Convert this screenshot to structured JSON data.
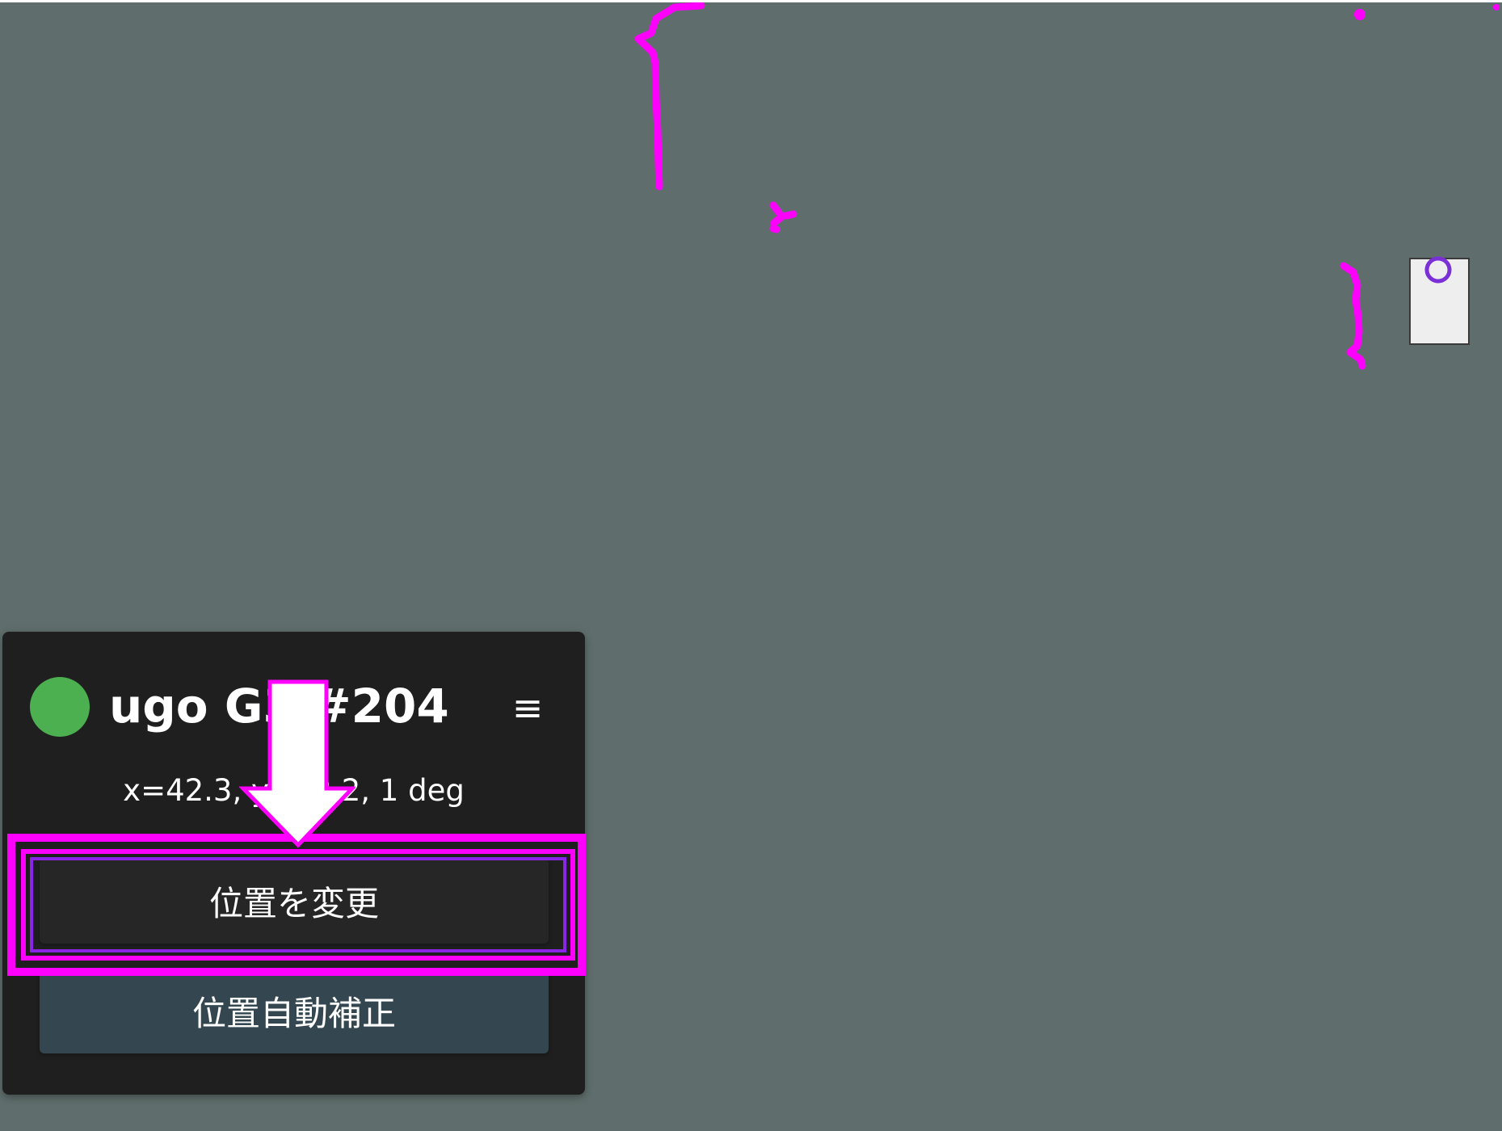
{
  "robot": {
    "name": "ugo G3 #204",
    "status_color": "#4caf50",
    "pose_text": "x=42.3, y=12.2, 1 deg"
  },
  "menu": {
    "icon": "hamburger-menu-icon",
    "glyph": "≡"
  },
  "buttons": {
    "change_position": "位置を変更",
    "auto_correct": "位置自動補正"
  },
  "colors": {
    "map_background": "#5f6e6c",
    "obstacle": "#ff00ff",
    "panel_background": "#1f1f1f",
    "highlight": "#ff00ff",
    "auto_correct_button": "#344750",
    "marker_ring": "#7b2fd6"
  },
  "annotation": {
    "arrow_icon": "down-arrow-icon",
    "highlight_target": "change-position-button"
  }
}
